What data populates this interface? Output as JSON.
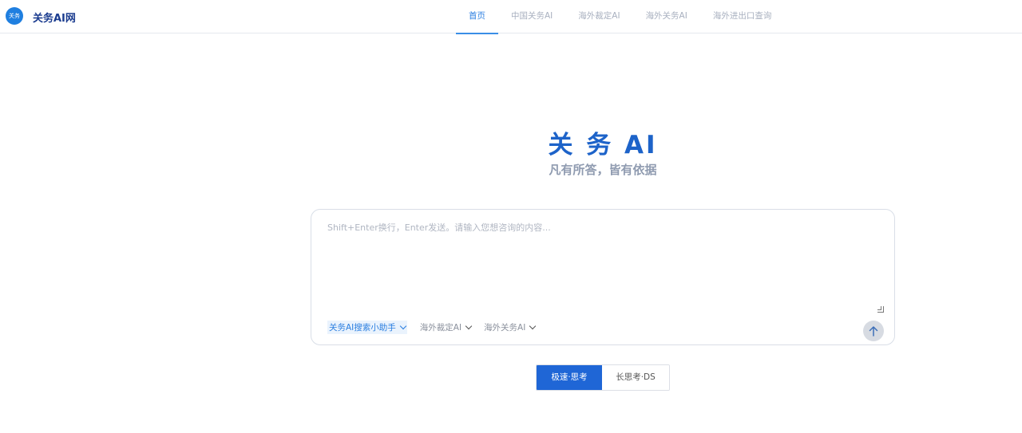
{
  "header": {
    "logo_text": "关务",
    "brand": "关务AI网",
    "nav": [
      {
        "label": "首页",
        "active": true
      },
      {
        "label": "中国关务AI",
        "active": false
      },
      {
        "label": "海外裁定AI",
        "active": false
      },
      {
        "label": "海外关务AI",
        "active": false
      },
      {
        "label": "海外进出口查询",
        "active": false
      }
    ]
  },
  "hero": {
    "title": "关 务 AI",
    "subtitle": "凡有所答，皆有依据"
  },
  "input": {
    "value": "",
    "placeholder": "Shift+Enter换行，Enter发送。请输入您想咨询的内容...",
    "tools": [
      {
        "label": "关务AI搜索小助手",
        "active": true,
        "icon": "chevron-down-icon"
      },
      {
        "label": "海外裁定AI",
        "active": false,
        "icon": "chevron-down-icon"
      },
      {
        "label": "海外关务AI",
        "active": false,
        "icon": "chevron-down-icon"
      }
    ],
    "send_icon": "arrow-up-icon"
  },
  "modes": [
    {
      "label": "极速·思考",
      "active": true
    },
    {
      "label": "长思考·DS",
      "active": false
    }
  ],
  "colors": {
    "accent": "#1f66d6",
    "title": "#1d63c9",
    "nav_active": "#2a7ee0"
  }
}
